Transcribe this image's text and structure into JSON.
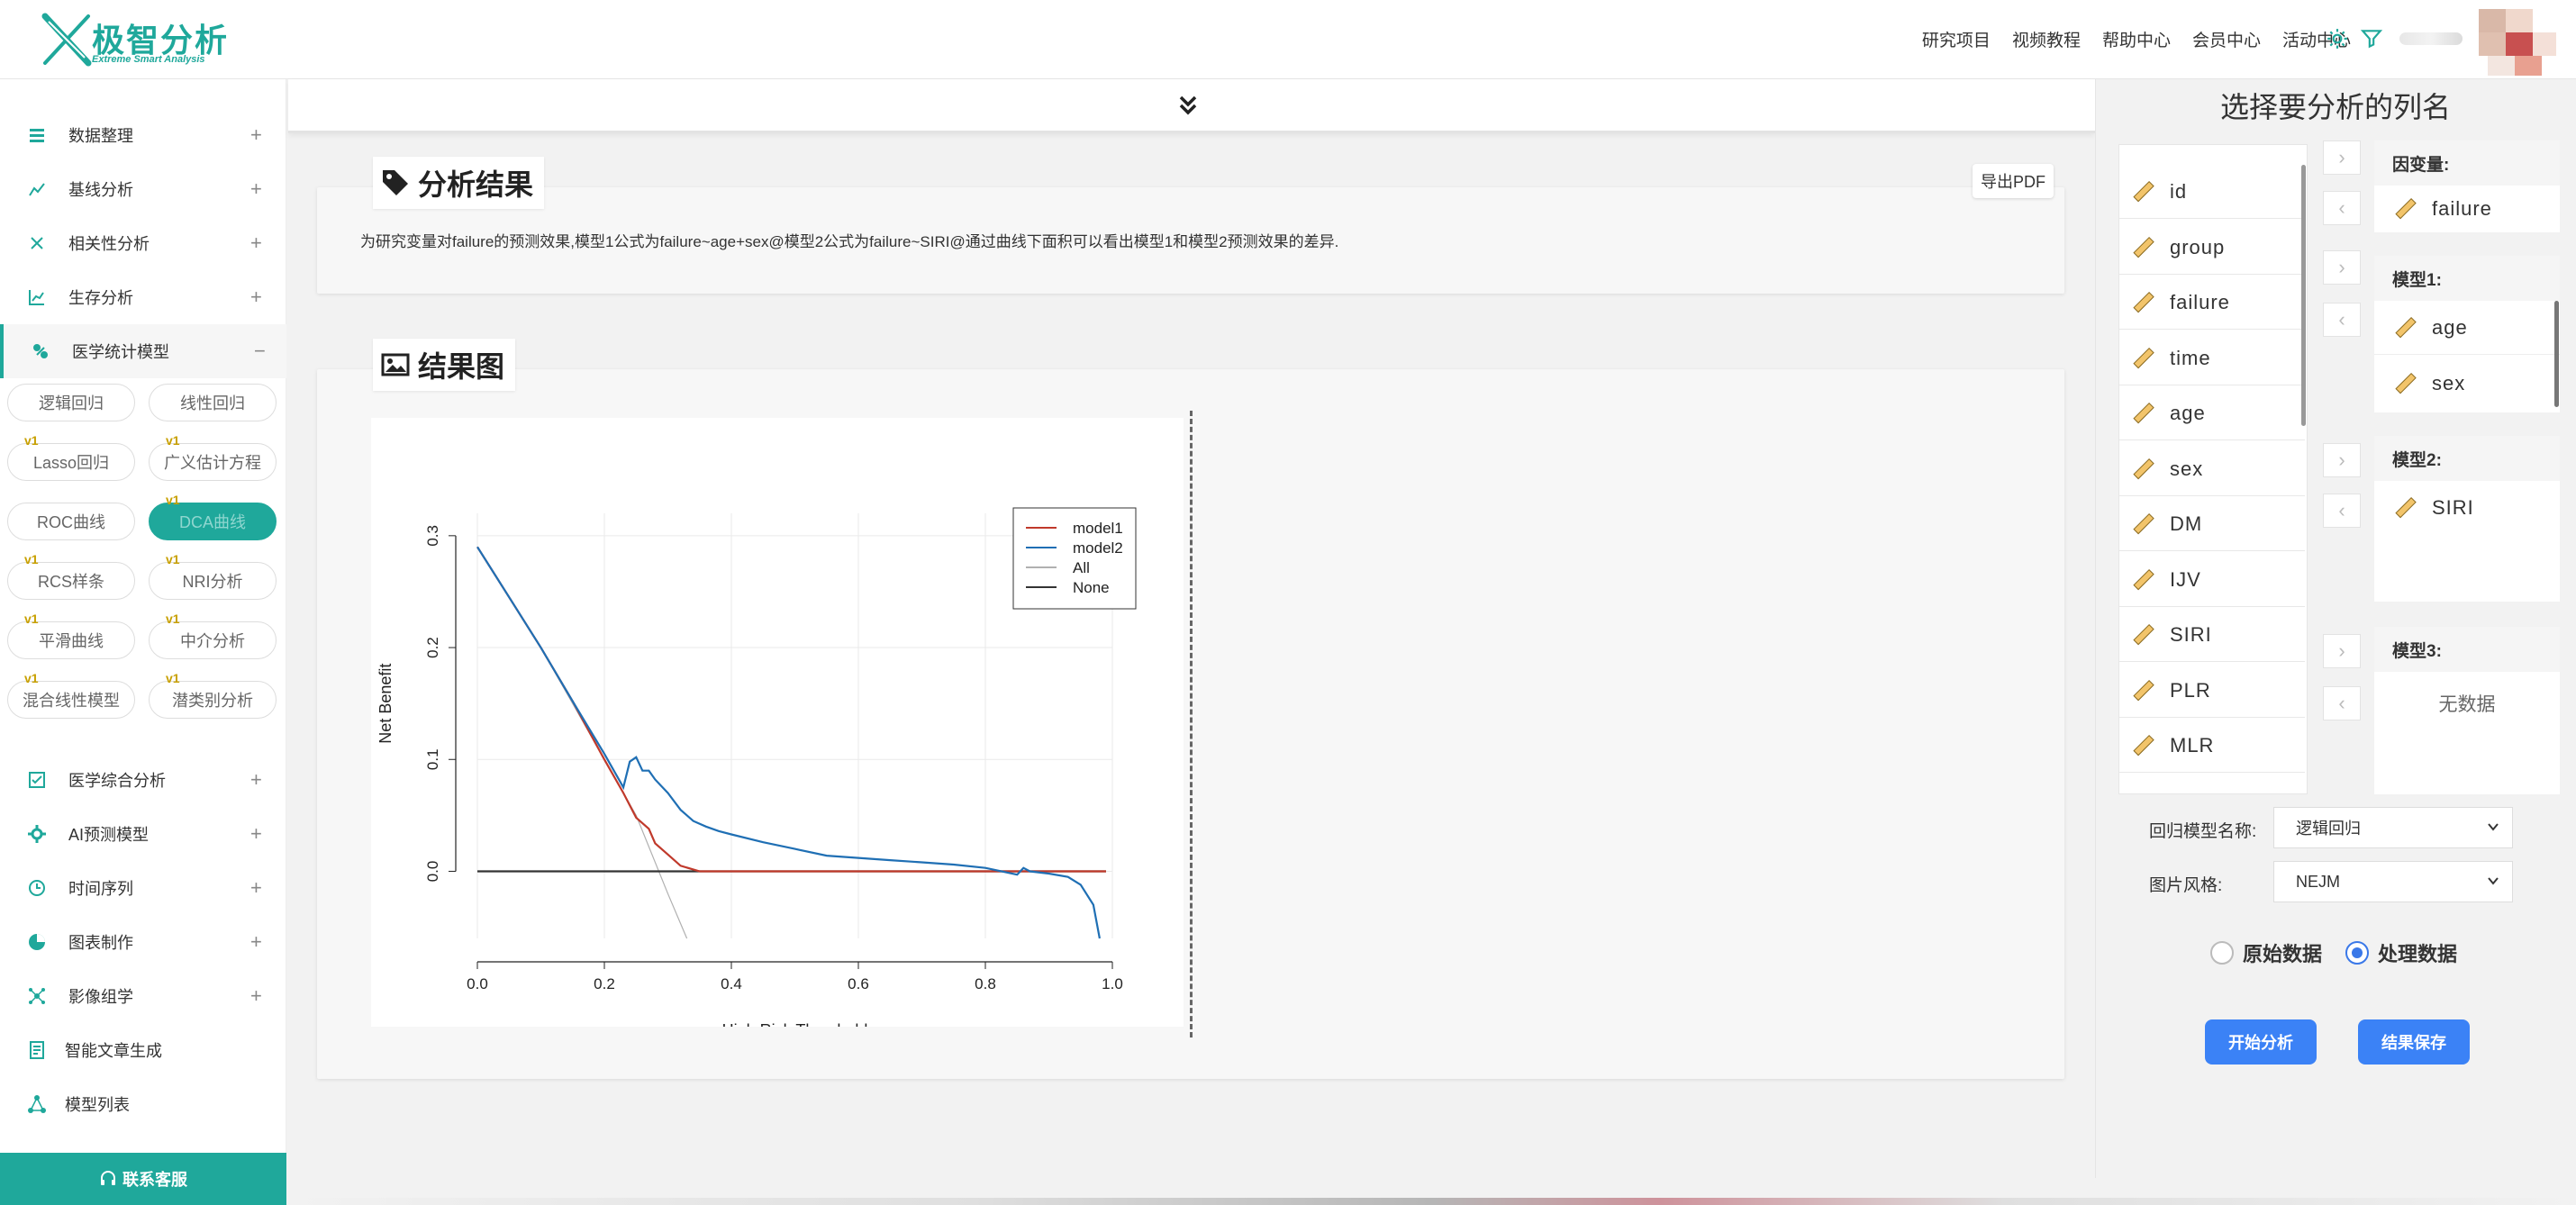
{
  "header": {
    "brand": "极智分析",
    "brand_sub": "Extreme Smart Analysis",
    "nav": [
      "研究项目",
      "视频教程",
      "帮助中心",
      "会员中心",
      "活动中心"
    ]
  },
  "sidebar": {
    "items": [
      {
        "label": "数据整理",
        "expander": "+"
      },
      {
        "label": "基线分析",
        "expander": "+"
      },
      {
        "label": "相关性分析",
        "expander": "+"
      },
      {
        "label": "生存分析",
        "expander": "+"
      },
      {
        "label": "医学统计模型",
        "expander": "−"
      }
    ],
    "sub_buttons": [
      {
        "label": "逻辑回归",
        "tag": ""
      },
      {
        "label": "线性回归",
        "tag": ""
      },
      {
        "label": "Lasso回归",
        "tag": "v1"
      },
      {
        "label": "广义估计方程",
        "tag": "v1"
      },
      {
        "label": "ROC曲线",
        "tag": ""
      },
      {
        "label": "DCA曲线",
        "tag": "v1"
      },
      {
        "label": "RCS样条",
        "tag": "v1"
      },
      {
        "label": "NRI分析",
        "tag": "v1"
      },
      {
        "label": "平滑曲线",
        "tag": "v1"
      },
      {
        "label": "中介分析",
        "tag": "v1"
      },
      {
        "label": "混合线性模型",
        "tag": "v1"
      },
      {
        "label": "潜类别分析",
        "tag": "v1"
      }
    ],
    "items_lower": [
      {
        "label": "医学综合分析",
        "expander": "+"
      },
      {
        "label": "AI预测模型",
        "expander": "+"
      },
      {
        "label": "时间序列",
        "expander": "+"
      },
      {
        "label": "图表制作",
        "expander": "+"
      },
      {
        "label": "影像组学",
        "expander": "+"
      },
      {
        "label": "智能文章生成",
        "expander": ""
      },
      {
        "label": "模型列表",
        "expander": ""
      }
    ],
    "service": "联系客服"
  },
  "main": {
    "result_title": "分析结果",
    "result_text": "为研究变量对failure的预测效果,模型1公式为failure~age+sex@模型2公式为failure~SIRI@通过曲线下面积可以看出模型1和模型2预测效果的差异.",
    "export_pdf": "导出PDF",
    "chart_title": "结果图"
  },
  "chart_data": {
    "type": "line",
    "title": "",
    "xlabel": "High Risk Threshold",
    "ylabel": "Net Benefit",
    "xlim": [
      0,
      1
    ],
    "ylim": [
      -0.06,
      0.32
    ],
    "x_ticks": [
      "0.0",
      "0.2",
      "0.4",
      "0.6",
      "0.8",
      "1.0"
    ],
    "y_ticks": [
      "0.0",
      "0.1",
      "0.2",
      "0.3"
    ],
    "legend_position": "top-right",
    "grid": true,
    "series": [
      {
        "name": "model1",
        "color": "#c0392b",
        "x": [
          0.0,
          0.05,
          0.1,
          0.15,
          0.2,
          0.23,
          0.25,
          0.27,
          0.28,
          0.3,
          0.32,
          0.35,
          0.5,
          0.7,
          0.9,
          0.99
        ],
        "y": [
          0.29,
          0.245,
          0.2,
          0.152,
          0.1,
          0.07,
          0.048,
          0.038,
          0.025,
          0.015,
          0.005,
          0.0,
          0.0,
          0.0,
          0.0,
          0.0
        ]
      },
      {
        "name": "model2",
        "color": "#1f6fb4",
        "x": [
          0.0,
          0.05,
          0.1,
          0.15,
          0.2,
          0.22,
          0.23,
          0.24,
          0.25,
          0.26,
          0.27,
          0.28,
          0.3,
          0.32,
          0.34,
          0.36,
          0.38,
          0.4,
          0.45,
          0.5,
          0.55,
          0.6,
          0.65,
          0.7,
          0.75,
          0.8,
          0.85,
          0.86,
          0.87,
          0.9,
          0.93,
          0.95,
          0.97,
          0.98
        ],
        "y": [
          0.29,
          0.245,
          0.2,
          0.152,
          0.105,
          0.085,
          0.075,
          0.098,
          0.102,
          0.09,
          0.09,
          0.082,
          0.07,
          0.055,
          0.045,
          0.04,
          0.036,
          0.033,
          0.026,
          0.02,
          0.014,
          0.012,
          0.01,
          0.008,
          0.006,
          0.003,
          -0.003,
          0.003,
          0.0,
          -0.002,
          -0.005,
          -0.012,
          -0.03,
          -0.06
        ]
      },
      {
        "name": "All",
        "color": "#b0b0b0",
        "x": [
          0.0,
          0.1,
          0.2,
          0.25,
          0.3,
          0.33
        ],
        "y": [
          0.29,
          0.2,
          0.1,
          0.05,
          -0.02,
          -0.06
        ]
      },
      {
        "name": "None",
        "color": "#333333",
        "x": [
          0.0,
          0.99
        ],
        "y": [
          0.0,
          0.0
        ]
      }
    ]
  },
  "right": {
    "title": "选择要分析的列名",
    "columns": [
      "id",
      "group",
      "failure",
      "time",
      "age",
      "sex",
      "DM",
      "IJV",
      "SIRI",
      "PLR",
      "MLR"
    ],
    "dependent_label": "因变量:",
    "dependent": [
      "failure"
    ],
    "model1_label": "模型1:",
    "model1": [
      "age",
      "sex"
    ],
    "model2_label": "模型2:",
    "model2": [
      "SIRI"
    ],
    "model3_label": "模型3:",
    "model3_empty": "无数据",
    "arrow_right": "›",
    "arrow_left": "‹",
    "reg_label": "回归模型名称:",
    "reg_value": "逻辑回归",
    "style_label": "图片风格:",
    "style_value": "NEJM",
    "radio_raw": "原始数据",
    "radio_processed": "处理数据",
    "start_btn": "开始分析",
    "save_btn": "结果保存"
  },
  "colors": {
    "brand": "#1fa89b",
    "primary": "#3b82f6",
    "model1": "#c0392b",
    "model2": "#1f6fb4"
  }
}
